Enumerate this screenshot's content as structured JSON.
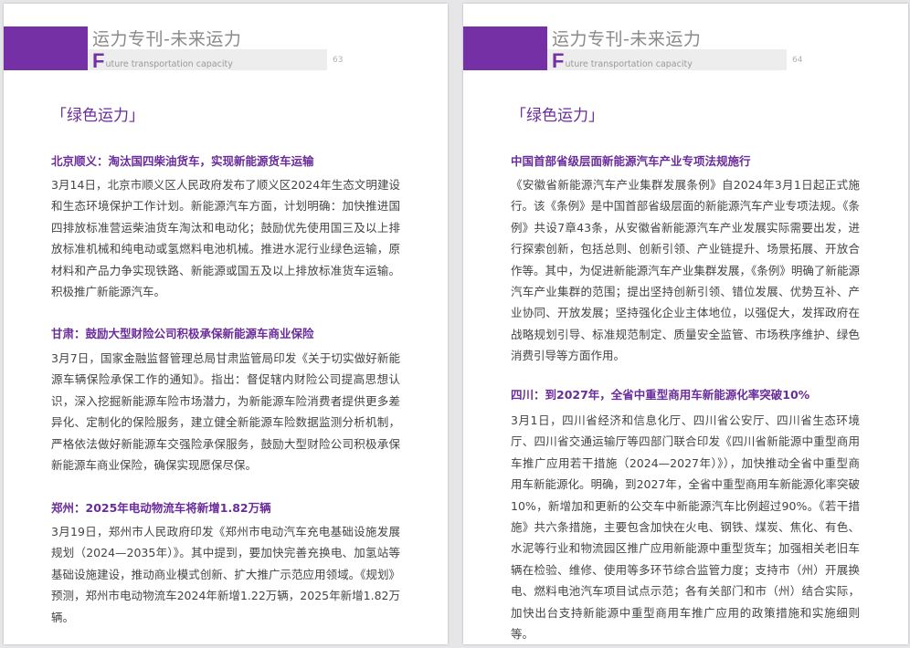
{
  "left_page": {
    "header": {
      "title": "运力专刊-未来运力",
      "subtitle_initial": "F",
      "subtitle_rest": "uture transportation capacity",
      "page_number": "63"
    },
    "section_tag": "「绿色运力」",
    "articles": [
      {
        "heading": "北京顺义：淘汰国四柴油货车，实现新能源货车运输",
        "body": "3月14日，北京市顺义区人民政府发布了顺义区2024年生态文明建设和生态环境保护工作计划。新能源汽车方面，计划明确：加快推进国四排放标准营运柴油货车淘汰和电动化；鼓励优先使用国三及以上排放标准机械和纯电动或氢燃料电池机械。推进水泥行业绿色运输，原材料和产品力争实现铁路、新能源或国五及以上排放标准货车运输。积极推广新能源汽车。"
      },
      {
        "heading": "甘肃：鼓励大型财险公司积极承保新能源车商业保险",
        "body": "3月7日，国家金融监督管理总局甘肃监管局印发《关于切实做好新能源车辆保险承保工作的通知》。指出：督促辖内财险公司提高思想认识，深入挖掘新能源车险市场潜力，为新能源车险消费者提供更多差异化、定制化的保险服务，建立健全新能源车险数据监测分析机制，严格依法做好新能源车交强险承保服务，鼓励大型财险公司积极承保新能源车商业保险，确保实现愿保尽保。"
      },
      {
        "heading": "郑州：2025年电动物流车将新增1.82万辆",
        "body": "3月19日，郑州市人民政府印发《郑州市电动汽车充电基础设施发展规划（2024—2035年）》。其中提到，要加快完善充换电、加氢站等基础设施建设，推动商业模式创新、扩大推广示范应用领域。《规划》预测，郑州市电动物流车2024年新增1.22万辆，2025年新增1.82万辆。"
      }
    ]
  },
  "right_page": {
    "header": {
      "title": "运力专刊-未来运力",
      "subtitle_initial": "F",
      "subtitle_rest": "uture transportation capacity",
      "page_number": "64"
    },
    "section_tag": "「绿色运力」",
    "articles": [
      {
        "heading": "中国首部省级层面新能源汽车产业专项法规施行",
        "body": "《安徽省新能源汽车产业集群发展条例》自2024年3月1日起正式施行。该《条例》是中国首部省级层面的新能源汽车产业专项法规。《条例》共设7章43条，从安徽省新能源汽车产业发展实际需要出发，进行探索创新，包括总则、创新引领、产业链提升、场景拓展、开放合作等。其中，为促进新能源汽车产业集群发展，《条例》明确了新能源汽车产业集群的范围；提出坚持创新引领、错位发展、优势互补、产业协同、开放发展；坚持强化企业主体地位，以强促大，发挥政府在战略规划引导、标准规范制定、质量安全监管、市场秩序维护、绿色消费引导等方面作用。"
      },
      {
        "heading": "四川：到2027年，全省中重型商用车新能源化率突破10%",
        "body": "3月1日，四川省经济和信息化厅、四川省公安厅、四川省生态环境厅、四川省交通运输厅等四部门联合印发《四川省新能源中重型商用车推广应用若干措施（2024—2027年）》），加快推动全省中重型商用车新能源化。明确，到2027年，全省中重型商用车新能源化率突破10%，新增加和更新的公交车中新能源汽车比例超过90%。《若干措施》共六条措施，主要包含加快在火电、钢铁、煤炭、焦化、有色、水泥等行业和物流园区推广应用新能源中重型货车；加强相关老旧车辆在检验、维修、使用等多环节综合监管力度；支持市（州）开展换电、燃料电池汽车项目试点示范；各有关部门和市（州）结合实际，加快出台支持新能源中重型商用车推广应用的政策措施和实施细则等。"
      }
    ]
  }
}
